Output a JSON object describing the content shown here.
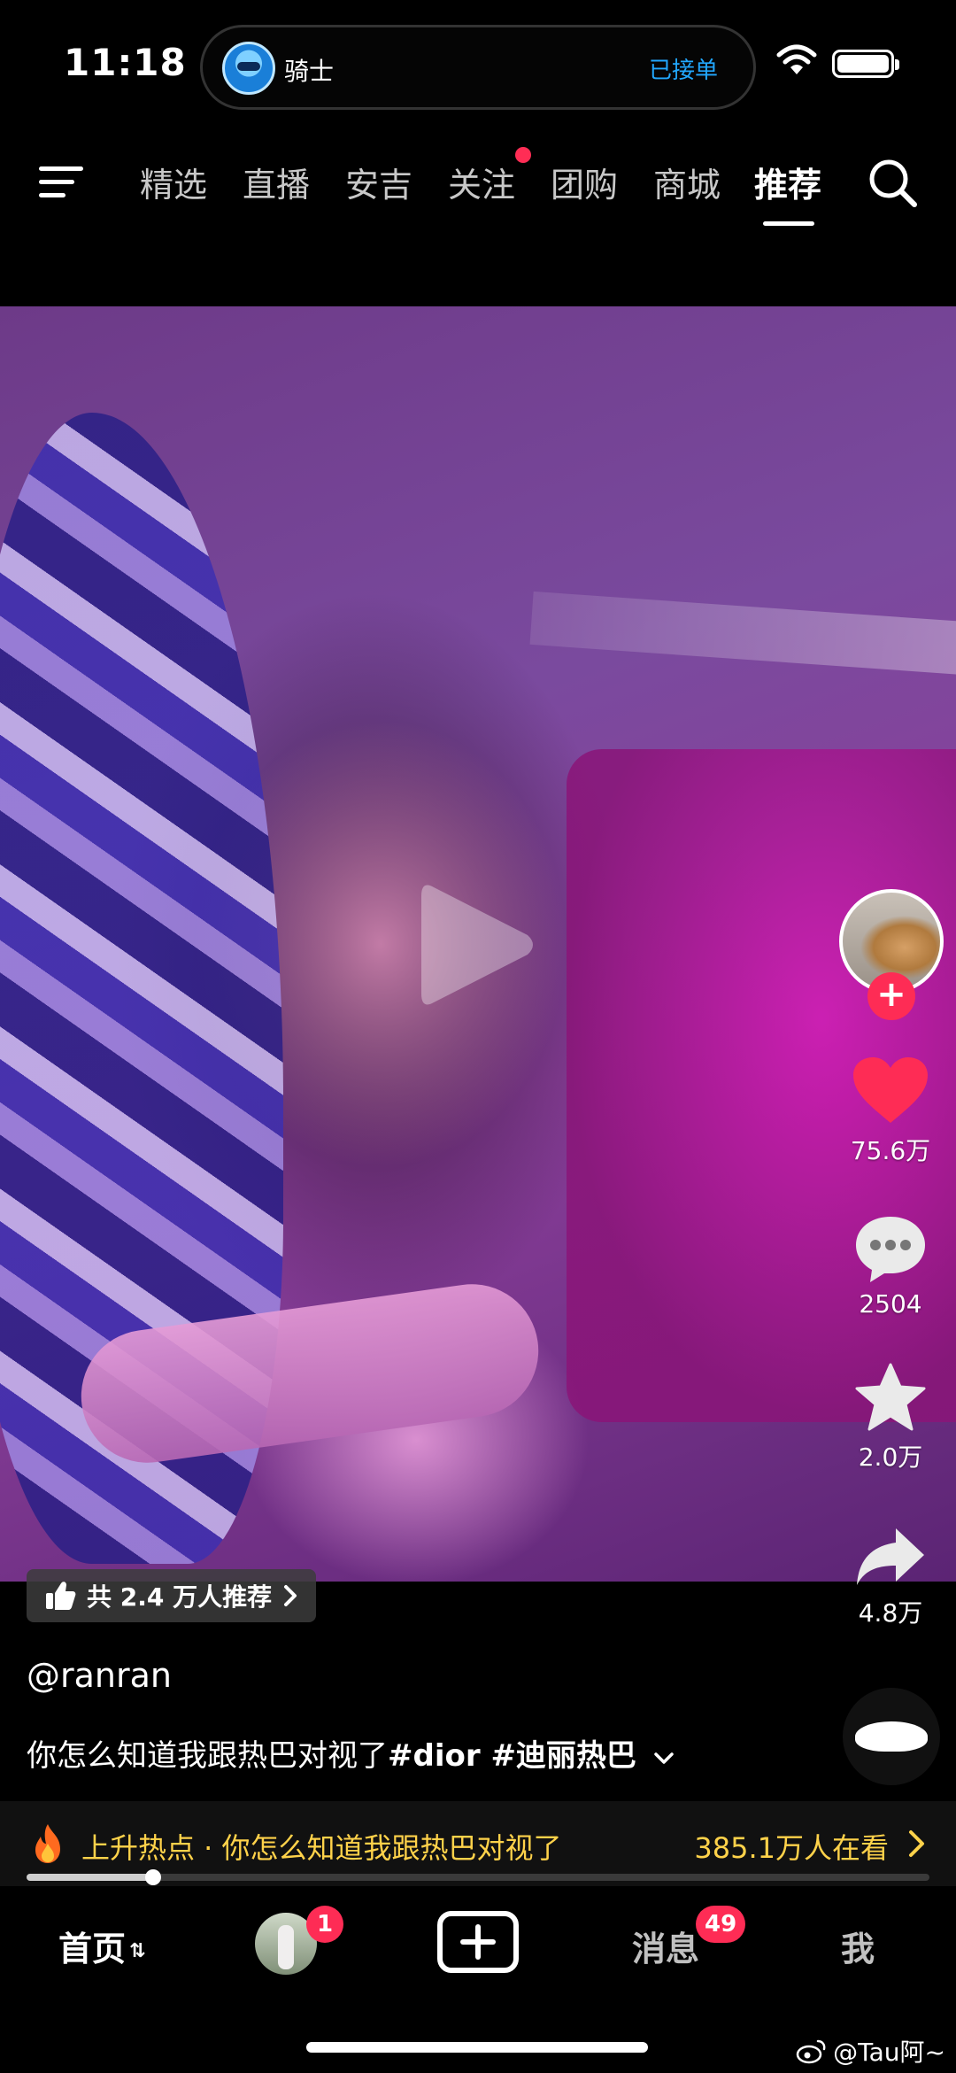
{
  "status_bar": {
    "time": "11:18",
    "island_title": "骑士",
    "island_status": "已接单",
    "island_status_color": "#22a8ff"
  },
  "top_nav": {
    "tabs": [
      {
        "label": "精选"
      },
      {
        "label": "直播"
      },
      {
        "label": "安吉"
      },
      {
        "label": "关注",
        "has_dot": true
      },
      {
        "label": "团购"
      },
      {
        "label": "商城"
      },
      {
        "label": "推荐",
        "active": true
      }
    ],
    "icons": [
      "menu-icon",
      "search-icon"
    ]
  },
  "video": {
    "play_icon": "play-icon",
    "actions": {
      "likes": "75.6万",
      "comments": "2504",
      "favorites": "2.0万",
      "shares": "4.8万"
    },
    "accent_color": "#fe2c55"
  },
  "info": {
    "recommend": "共 2.4 万人推荐",
    "author": "@ranran",
    "caption_text": "你怎么知道我跟热巴对视了",
    "caption_tags": "#dior #迪丽热巴"
  },
  "hot_bar": {
    "text": "上升热点 · 你怎么知道我跟热巴对视了",
    "viewers": "385.1万人在看",
    "color": "#ffd24a"
  },
  "progress": {
    "fraction": 0.14
  },
  "bottom_nav": {
    "home": "首页",
    "friends_badge": "1",
    "messages": "消息",
    "messages_badge": "49",
    "me": "我"
  },
  "watermark": "@Tau阿~"
}
